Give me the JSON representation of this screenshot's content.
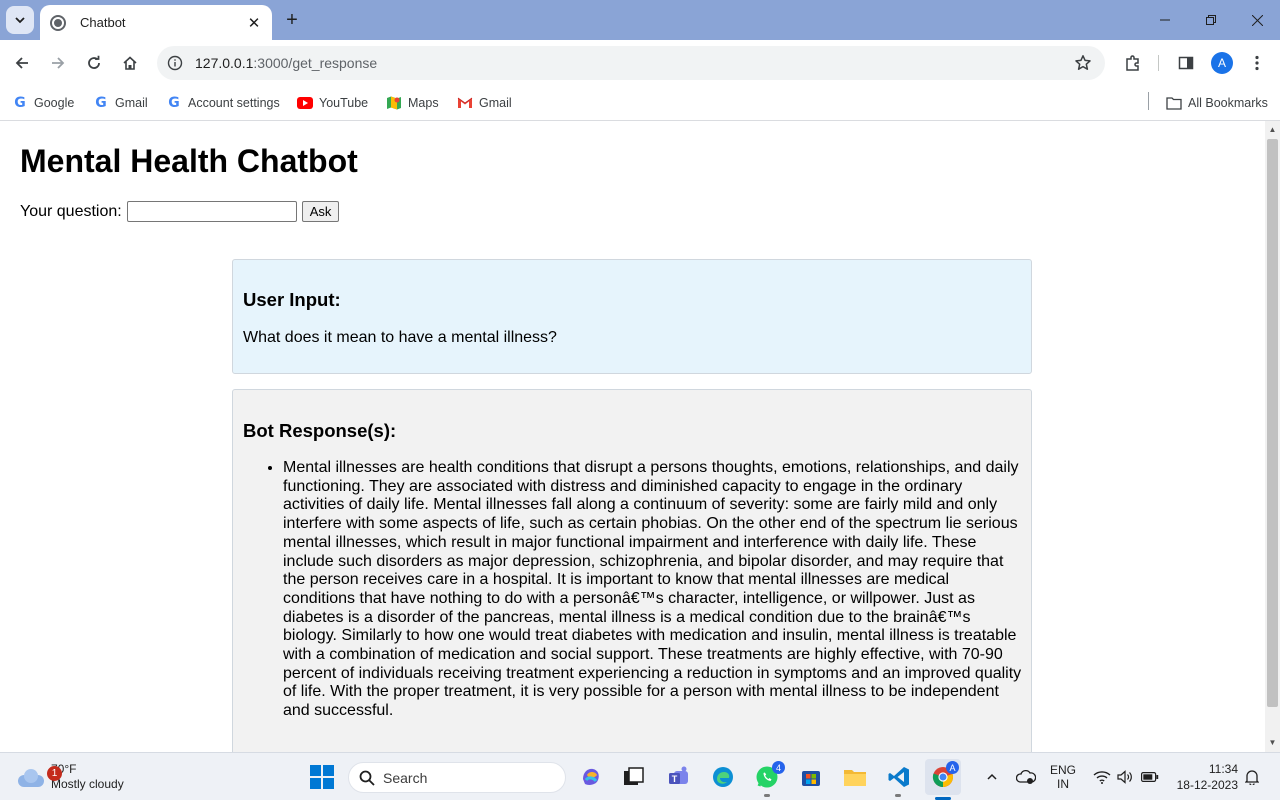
{
  "browser": {
    "tab_title": "Chatbot",
    "url_host": "127.0.0.1",
    "url_path": ":3000/get_response",
    "profile_initial": "A",
    "bookmarks": [
      {
        "label": "Google",
        "icon": "google-icon"
      },
      {
        "label": "Gmail",
        "icon": "google-icon"
      },
      {
        "label": "Account settings",
        "icon": "google-icon"
      },
      {
        "label": "YouTube",
        "icon": "youtube-icon"
      },
      {
        "label": "Maps",
        "icon": "maps-icon"
      },
      {
        "label": "Gmail",
        "icon": "gmail-icon"
      }
    ],
    "all_bookmarks_label": "All Bookmarks"
  },
  "page": {
    "title": "Mental Health Chatbot",
    "question_label": "Your question:",
    "question_value": "",
    "ask_button": "Ask",
    "user_input_heading": "User Input:",
    "user_input_text": "What does it mean to have a mental illness?",
    "bot_heading": "Bot Response(s):",
    "bot_responses": [
      "Mental illnesses are health conditions that disrupt a persons thoughts, emotions, relationships, and daily functioning. They are associated with distress and diminished capacity to engage in the ordinary activities of daily life. Mental illnesses fall along a continuum of severity: some are fairly mild and only interfere with some aspects of life, such as certain phobias. On the other end of the spectrum lie serious mental illnesses, which result in major functional impairment and interference with daily life. These include such disorders as major depression, schizophrenia, and bipolar disorder, and may require that the person receives care in a hospital. It is important to know that mental illnesses are medical conditions that have nothing to do with a personâ€™s character, intelligence, or willpower. Just as diabetes is a disorder of the pancreas, mental illness is a medical condition due to the brainâ€™s biology. Similarly to how one would treat diabetes with medication and insulin, mental illness is treatable with a combination of medication and social support. These treatments are highly effective, with 70-90 percent of individuals receiving treatment experiencing a reduction in symptoms and an improved quality of life. With the proper treatment, it is very possible for a person with mental illness to be independent and successful."
    ]
  },
  "taskbar": {
    "weather_temp": "70°F",
    "weather_desc": "Mostly cloudy",
    "weather_badge": "1",
    "search_label": "Search",
    "whatsapp_badge": "4",
    "lang_line1": "ENG",
    "lang_line2": "IN",
    "time": "11:34",
    "date": "18-12-2023"
  },
  "colors": {
    "chrome_frame": "#8aa4d6",
    "user_card_bg": "#e6f4fc",
    "bot_card_bg": "#f2f2f2",
    "accent": "#1a73e8"
  }
}
